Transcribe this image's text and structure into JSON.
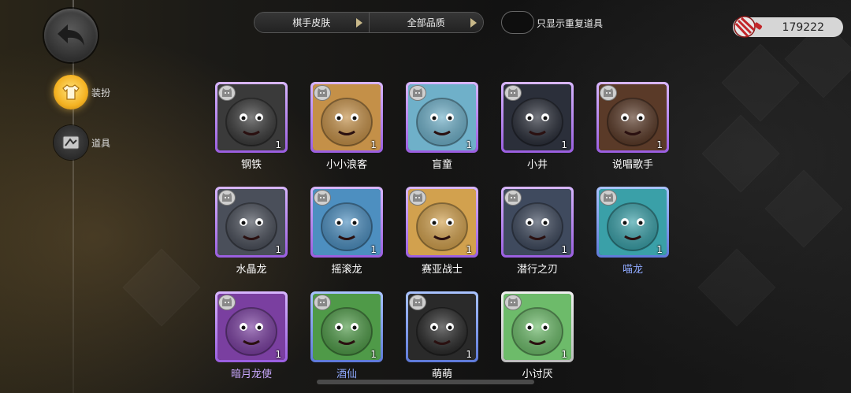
{
  "nav": {
    "back_icon": "back-arrow-icon",
    "items": [
      {
        "label": "装扮",
        "icon": "shirt-icon",
        "active": true
      },
      {
        "label": "道具",
        "icon": "item-icon",
        "active": false
      }
    ]
  },
  "filters": {
    "left_label": "棋手皮肤",
    "right_label": "全部品质"
  },
  "toggle": {
    "label": "只显示重复道具",
    "on": false
  },
  "currency": {
    "icon": "candy-icon",
    "amount": "179222"
  },
  "colors": {
    "accent": "#f4b222",
    "rarity_purple": "#b07af0",
    "rarity_blue": "#6f8de8",
    "rarity_gray": "#d0d0d0"
  },
  "items": [
    {
      "name": "钢铁",
      "count": "1",
      "rarity": "purple",
      "name_color": "white",
      "art": "#3a3a3a"
    },
    {
      "name": "小小浪客",
      "count": "1",
      "rarity": "purple",
      "name_color": "white",
      "art": "#c49048"
    },
    {
      "name": "盲童",
      "count": "1",
      "rarity": "purple",
      "name_color": "white",
      "art": "#6fb0c9"
    },
    {
      "name": "小井",
      "count": "1",
      "rarity": "purple",
      "name_color": "white",
      "art": "#2b2f3a"
    },
    {
      "name": "说唱歌手",
      "count": "1",
      "rarity": "purple",
      "name_color": "white",
      "art": "#5a3a28"
    },
    {
      "name": "水晶龙",
      "count": "1",
      "rarity": "purple",
      "name_color": "white",
      "art": "#4a4f5a"
    },
    {
      "name": "摇滚龙",
      "count": "1",
      "rarity": "purple",
      "name_color": "white",
      "art": "#4d8fc0"
    },
    {
      "name": "赛亚战士",
      "count": "1",
      "rarity": "purple",
      "name_color": "white",
      "art": "#d2a14e"
    },
    {
      "name": "潜行之刃",
      "count": "1",
      "rarity": "purple",
      "name_color": "white",
      "art": "#3f4a5e"
    },
    {
      "name": "喵龙",
      "count": "1",
      "rarity": "blue",
      "name_color": "blue",
      "art": "#3aa0a8"
    },
    {
      "name": "暗月龙使",
      "count": "1",
      "rarity": "purple",
      "name_color": "purple",
      "art": "#7a3fa0"
    },
    {
      "name": "酒仙",
      "count": "1",
      "rarity": "blue",
      "name_color": "blue",
      "art": "#4f9a48"
    },
    {
      "name": "萌萌",
      "count": "1",
      "rarity": "blue",
      "name_color": "white",
      "art": "#2a2a2a"
    },
    {
      "name": "小讨厌",
      "count": "1",
      "rarity": "gray",
      "name_color": "white",
      "art": "#6dbb6a"
    }
  ]
}
